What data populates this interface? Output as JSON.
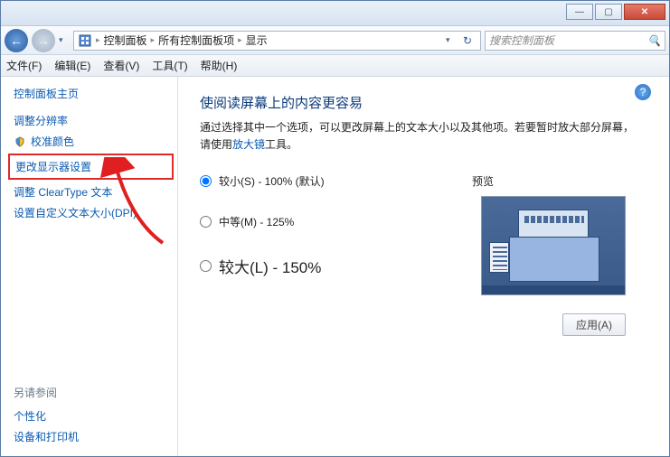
{
  "window": {
    "min": "—",
    "max": "▢",
    "close": "✕"
  },
  "nav": {
    "back": "←",
    "forward": "→"
  },
  "address": {
    "seg1": "控制面板",
    "seg2": "所有控制面板项",
    "seg3": "显示"
  },
  "search": {
    "placeholder": "搜索控制面板",
    "icon": "🔍"
  },
  "menu": {
    "file": "文件(F)",
    "edit": "编辑(E)",
    "view": "查看(V)",
    "tools": "工具(T)",
    "help": "帮助(H)"
  },
  "sidebar": {
    "home": "控制面板主页",
    "items": [
      "调整分辨率",
      "校准颜色",
      "更改显示器设置",
      "调整 ClearType 文本",
      "设置自定义文本大小(DPI)"
    ],
    "see_also": "另请参阅",
    "footer": [
      "个性化",
      "设备和打印机"
    ]
  },
  "main": {
    "title": "使阅读屏幕上的内容更容易",
    "desc_before": "通过选择其中一个选项，可以更改屏幕上的文本大小以及其他项。若要暂时放大部分屏幕，请使用",
    "desc_link": "放大镜",
    "desc_after": "工具。",
    "options": [
      {
        "label": "较小(S) - 100% (默认)",
        "selected": true
      },
      {
        "label": "中等(M) - 125%",
        "selected": false
      },
      {
        "label": "较大(L) - 150%",
        "selected": false
      }
    ],
    "preview_label": "预览",
    "apply": "应用(A)",
    "help": "?"
  }
}
